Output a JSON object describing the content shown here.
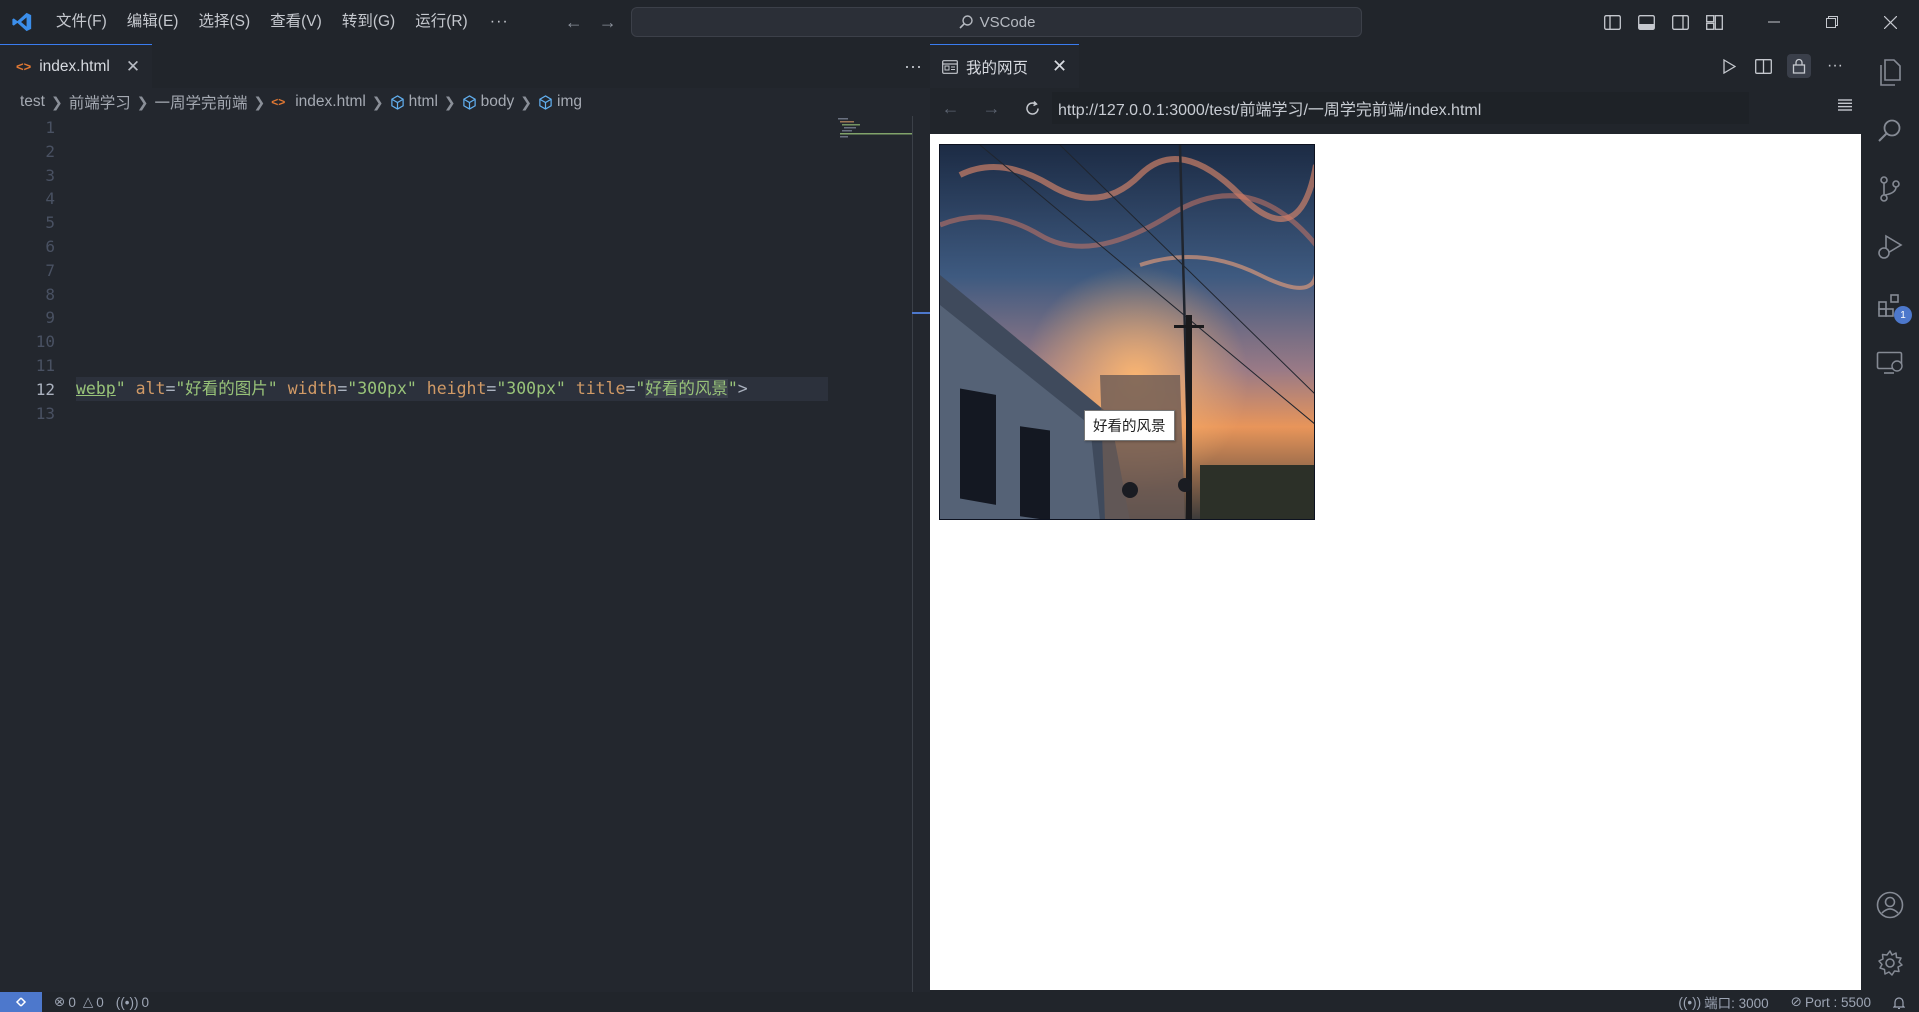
{
  "titlebar": {
    "menu": [
      "文件(F)",
      "编辑(E)",
      "选择(S)",
      "查看(V)",
      "转到(G)",
      "运行(R)"
    ],
    "more": "···",
    "search_text": "VSCode"
  },
  "editor": {
    "tab_label": "index.html",
    "more": "···",
    "breadcrumb": [
      "test",
      "前端学习",
      "一周学完前端",
      "index.html",
      "html",
      "body",
      "img"
    ],
    "line_numbers": [
      "1",
      "2",
      "3",
      "4",
      "5",
      "6",
      "7",
      "8",
      "9",
      "10",
      "11",
      "12",
      "13"
    ],
    "active_line": "12",
    "code": {
      "src_tail": "webp",
      "q1": "\"",
      "alt_attr": "alt",
      "eq": "=",
      "alt_val": "\"好看的图片\"",
      "width_attr": "width",
      "width_val": "\"300px\"",
      "height_attr": "height",
      "height_val": "\"300px\"",
      "title_attr": "title",
      "title_open": "\"",
      "title_val": "好看的风景",
      "title_close": "\"",
      "tag_close": ">"
    }
  },
  "preview": {
    "tab_label": "我的网页",
    "url": "http://127.0.0.1:3000/test/前端学习/一周学完前端/index.html",
    "tooltip": "好看的风景"
  },
  "activity": {
    "extensions_badge": "1"
  },
  "statusbar": {
    "errors": "0",
    "warnings": "0",
    "ports": "0",
    "port_forward": "端口: 3000",
    "live_server": "Port : 5500"
  },
  "colors": {
    "accent": "#4d78cc",
    "background": "#21252b",
    "editor_bg": "#23272e",
    "string": "#98c379",
    "attribute": "#d19a66"
  }
}
